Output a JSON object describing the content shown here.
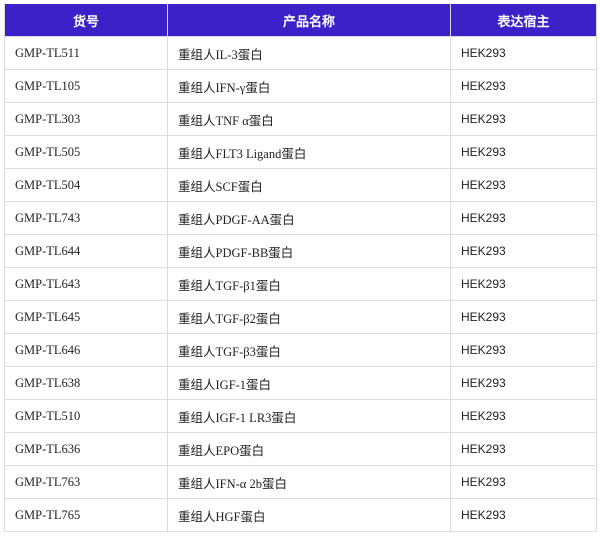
{
  "table": {
    "headers": [
      "货号",
      "产品名称",
      "表达宿主"
    ],
    "rows": [
      [
        "GMP-TL511",
        "重组人IL-3蛋白",
        "HEK293"
      ],
      [
        "GMP-TL105",
        "重组人IFN-γ蛋白",
        "HEK293"
      ],
      [
        "GMP-TL303",
        "重组人TNF α蛋白",
        "HEK293"
      ],
      [
        "GMP-TL505",
        "重组人FLT3 Ligand蛋白",
        "HEK293"
      ],
      [
        "GMP-TL504",
        "重组人SCF蛋白",
        "HEK293"
      ],
      [
        "GMP-TL743",
        "重组人PDGF-AA蛋白",
        "HEK293"
      ],
      [
        "GMP-TL644",
        "重组人PDGF-BB蛋白",
        "HEK293"
      ],
      [
        "GMP-TL643",
        "重组人TGF-β1蛋白",
        "HEK293"
      ],
      [
        "GMP-TL645",
        "重组人TGF-β2蛋白",
        "HEK293"
      ],
      [
        "GMP-TL646",
        "重组人TGF-β3蛋白",
        "HEK293"
      ],
      [
        "GMP-TL638",
        "重组人IGF-1蛋白",
        "HEK293"
      ],
      [
        "GMP-TL510",
        "重组人IGF-1 LR3蛋白",
        "HEK293"
      ],
      [
        "GMP-TL636",
        "重组人EPO蛋白",
        "HEK293"
      ],
      [
        "GMP-TL763",
        "重组人IFN-α 2b蛋白",
        "HEK293"
      ],
      [
        "GMP-TL765",
        "重组人HGF蛋白",
        "HEK293"
      ]
    ]
  },
  "colors": {
    "header_background": "#3b22c8",
    "header_text": "#ffffff",
    "border": "#dcdcdc"
  }
}
